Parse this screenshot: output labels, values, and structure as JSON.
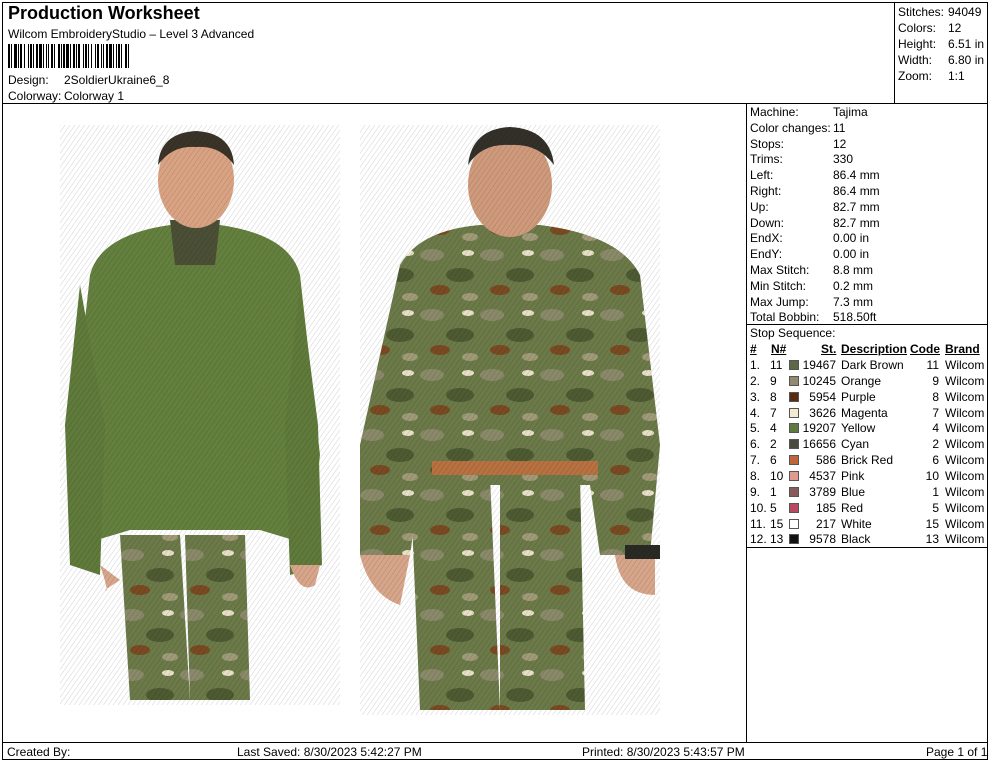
{
  "header": {
    "title": "Production Worksheet",
    "software": "Wilcom EmbroideryStudio – Level 3 Advanced",
    "design_label": "Design:",
    "design_value": "2SoldierUkraine6_8",
    "colorway_label": "Colorway:",
    "colorway_value": "Colorway 1"
  },
  "summary": [
    {
      "label": "Stitches:",
      "value": "94049"
    },
    {
      "label": "Colors:",
      "value": "12"
    },
    {
      "label": "Height:",
      "value": "6.51 in"
    },
    {
      "label": "Width:",
      "value": "6.80 in"
    },
    {
      "label": "Zoom:",
      "value": "1:1"
    }
  ],
  "machine_stats": [
    {
      "label": "Machine:",
      "value": "Tajima"
    },
    {
      "label": "Color changes:",
      "value": "11"
    },
    {
      "label": "Stops:",
      "value": "12"
    },
    {
      "label": "Trims:",
      "value": "330"
    },
    {
      "label": "Left:",
      "value": "86.4 mm"
    },
    {
      "label": "Right:",
      "value": "86.4 mm"
    },
    {
      "label": "Up:",
      "value": "82.7 mm"
    },
    {
      "label": "Down:",
      "value": "82.7 mm"
    },
    {
      "label": "EndX:",
      "value": "0.00 in"
    },
    {
      "label": "EndY:",
      "value": "0.00 in"
    },
    {
      "label": "Max Stitch:",
      "value": "8.8 mm"
    },
    {
      "label": "Min Stitch:",
      "value": "0.2 mm"
    },
    {
      "label": "Max Jump:",
      "value": "7.3 mm"
    },
    {
      "label": "Total Bobbin:",
      "value": "518.50ft"
    }
  ],
  "stop_sequence": {
    "title": "Stop Sequence:",
    "headers": {
      "num": "#",
      "n": "N#",
      "st": "St.",
      "desc": "Description",
      "code": "Code",
      "brand": "Brand"
    },
    "rows": [
      {
        "num": "1.",
        "n": "11",
        "color": "#5e6848",
        "st": "19467",
        "desc": "Dark Brown",
        "code": "11",
        "brand": "Wilcom"
      },
      {
        "num": "2.",
        "n": "9",
        "color": "#8f8a70",
        "st": "10245",
        "desc": "Orange",
        "code": "9",
        "brand": "Wilcom"
      },
      {
        "num": "3.",
        "n": "8",
        "color": "#5a2a10",
        "st": "5954",
        "desc": "Purple",
        "code": "8",
        "brand": "Wilcom"
      },
      {
        "num": "4.",
        "n": "7",
        "color": "#f3ead0",
        "st": "3626",
        "desc": "Magenta",
        "code": "7",
        "brand": "Wilcom"
      },
      {
        "num": "5.",
        "n": "4",
        "color": "#5d7a3f",
        "st": "19207",
        "desc": "Yellow",
        "code": "4",
        "brand": "Wilcom"
      },
      {
        "num": "6.",
        "n": "2",
        "color": "#4a4a40",
        "st": "16656",
        "desc": "Cyan",
        "code": "2",
        "brand": "Wilcom"
      },
      {
        "num": "7.",
        "n": "6",
        "color": "#c0653a",
        "st": "586",
        "desc": "Brick Red",
        "code": "6",
        "brand": "Wilcom"
      },
      {
        "num": "8.",
        "n": "10",
        "color": "#e19a8e",
        "st": "4537",
        "desc": "Pink",
        "code": "10",
        "brand": "Wilcom"
      },
      {
        "num": "9.",
        "n": "1",
        "color": "#8a5a5a",
        "st": "3789",
        "desc": "Blue",
        "code": "1",
        "brand": "Wilcom"
      },
      {
        "num": "10.",
        "n": "5",
        "color": "#b84a60",
        "st": "185",
        "desc": "Red",
        "code": "5",
        "brand": "Wilcom"
      },
      {
        "num": "11.",
        "n": "15",
        "color": "#ffffff",
        "st": "217",
        "desc": "White",
        "code": "15",
        "brand": "Wilcom"
      },
      {
        "num": "12.",
        "n": "13",
        "color": "#111111",
        "st": "9578",
        "desc": "Black",
        "code": "13",
        "brand": "Wilcom"
      }
    ]
  },
  "footer": {
    "created_by": "Created By:",
    "last_saved": "Last Saved: 8/30/2023 5:42:27 PM",
    "printed": "Printed: 8/30/2023 5:43:57 PM",
    "page": "Page 1 of 1"
  }
}
